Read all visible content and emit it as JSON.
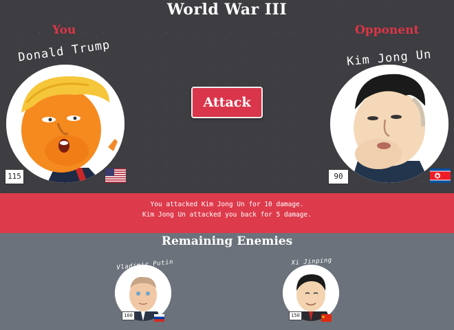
{
  "header": {
    "title": "World War III"
  },
  "player": {
    "side_label": "You",
    "name": "Donald Trump",
    "hp": 115,
    "flag_icon": "usa-flag-icon"
  },
  "opponent": {
    "side_label": "Opponent",
    "name": "Kim Jong Un",
    "hp": 90,
    "flag_icon": "north-korea-flag-icon"
  },
  "controls": {
    "attack_label": "Attack"
  },
  "battle_log": [
    "You attacked Kim Jong Un for 10 damage.",
    "Kim Jong Un attacked you back for 5 damage."
  ],
  "remaining": {
    "title": "Remaining Enemies",
    "enemies": [
      {
        "name": "Vladimir Putin",
        "hp": 160,
        "flag_icon": "russia-flag-icon"
      },
      {
        "name": "Xi Jinping",
        "hp": 150,
        "flag_icon": "china-flag-icon"
      }
    ]
  },
  "colors": {
    "accent_red": "#dd3a4b",
    "top_bg": "#3d3d42",
    "bottom_bg": "#6b727b"
  }
}
